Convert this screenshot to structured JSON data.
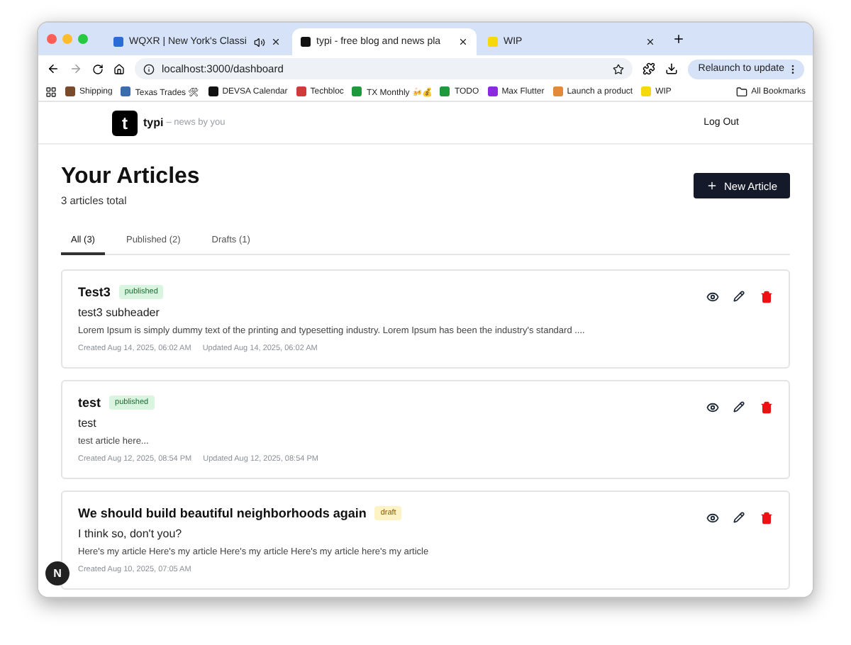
{
  "browser": {
    "tabs": [
      {
        "title": "WQXR | New York's Classi",
        "selected": false,
        "audio": true,
        "color": "#2b6cd9"
      },
      {
        "title": "typi - free blog and news pla",
        "selected": true,
        "audio": false,
        "color": "#111111"
      },
      {
        "title": "WIP",
        "selected": false,
        "audio": false,
        "color": "#f5d90a"
      }
    ],
    "url": "localhost:3000/dashboard",
    "relaunch": "Relaunch to update",
    "bookmarks": [
      {
        "label": "Shipping",
        "color": "#7a4a2a"
      },
      {
        "label": "Texas Trades 🛠",
        "color": "#3a6db0"
      },
      {
        "label": "DEVSA Calendar",
        "color": "#111111"
      },
      {
        "label": "Techbloc",
        "color": "#d13a3a"
      },
      {
        "label": "TX Monthly 🍻💰",
        "color": "#1e9a3c"
      },
      {
        "label": "TODO",
        "color": "#1e9a3c"
      },
      {
        "label": "Max Flutter",
        "color": "#8a2be2"
      },
      {
        "label": "Launch a product",
        "color": "#e08a3a"
      },
      {
        "label": "WIP",
        "color": "#f5d90a"
      }
    ],
    "all_bookmarks": "All Bookmarks"
  },
  "app": {
    "logo_letter": "t",
    "name": "typi",
    "tagline": "– news by you",
    "logout": "Log Out"
  },
  "page": {
    "title": "Your Articles",
    "subtitle": "3 articles total",
    "new_button": "New Article",
    "filters": [
      {
        "label": "All (3)",
        "selected": true
      },
      {
        "label": "Published (2)",
        "selected": false
      },
      {
        "label": "Drafts (1)",
        "selected": false
      }
    ]
  },
  "articles": [
    {
      "title": "Test3",
      "status": "published",
      "kind": "published",
      "subheader": "test3 subheader",
      "excerpt": "Lorem Ipsum is simply dummy text of the printing and typesetting industry. Lorem Ipsum has been the industry's standard ....",
      "created": "Created Aug 14, 2025, 06:02 AM",
      "updated": "Updated Aug 14, 2025, 06:02 AM"
    },
    {
      "title": "test",
      "status": "published",
      "kind": "published",
      "subheader": "test",
      "excerpt": "test article here...",
      "created": "Created Aug 12, 2025, 08:54 PM",
      "updated": "Updated Aug 12, 2025, 08:54 PM"
    },
    {
      "title": "We should build beautiful neighborhoods again",
      "status": "draft",
      "kind": "draft",
      "subheader": "I think so, don't you?",
      "excerpt": "Here's my article Here's my article Here's my article Here's my article here's my article",
      "created": "Created Aug 10, 2025, 07:05 AM"
    }
  ],
  "dev_badge": "N"
}
